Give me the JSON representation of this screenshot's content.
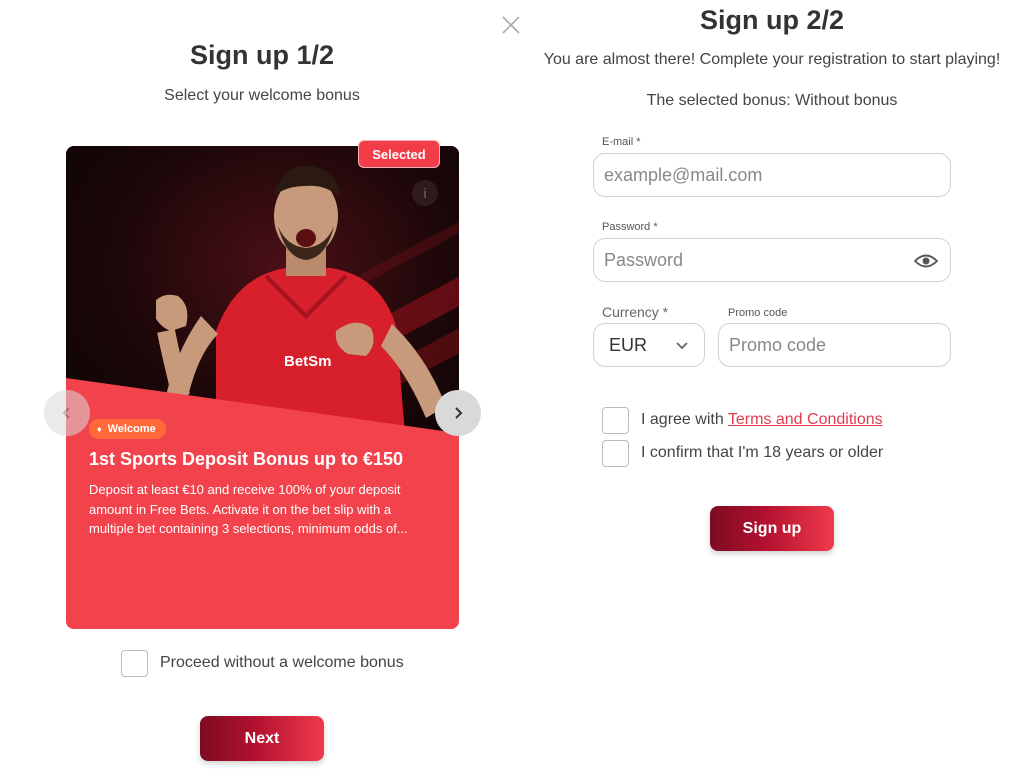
{
  "step1": {
    "title": "Sign up 1/2",
    "subtitle": "Select your welcome bonus",
    "card": {
      "badge": "Selected",
      "tag": "Welcome",
      "title": "1st Sports Deposit Bonus up to €150",
      "description": "Deposit at least €10 and receive 100% of your deposit amount in Free Bets. Activate it on the bet slip with a multiple bet containing 3 selections, minimum odds of...",
      "jersey_text": "BetSm"
    },
    "checkbox_label": "Proceed without a welcome bonus",
    "next_label": "Next"
  },
  "step2": {
    "title": "Sign up 2/2",
    "subtitle": "You are almost there! Complete your registration to start playing!",
    "selected_bonus": "The selected bonus: Without bonus",
    "email": {
      "label": "E-mail *",
      "placeholder": "example@mail.com"
    },
    "password": {
      "label": "Password *",
      "placeholder": "Password"
    },
    "currency": {
      "label": "Currency *",
      "value": "EUR"
    },
    "promo": {
      "label": "Promo code",
      "placeholder": "Promo code"
    },
    "agree_prefix": "I agree with ",
    "terms_link": "Terms and Conditions",
    "age_label": "I confirm that I'm 18 years or older",
    "signup_label": "Sign up"
  },
  "colors": {
    "accent": "#f2424c",
    "button_dark": "#7e0b22",
    "link": "#e23b4e",
    "tag": "#ff6a3a"
  },
  "icons": [
    "close-icon",
    "info-icon",
    "chevron-left-icon",
    "chevron-right-icon",
    "eye-icon",
    "chevron-down-icon",
    "flame-icon"
  ]
}
